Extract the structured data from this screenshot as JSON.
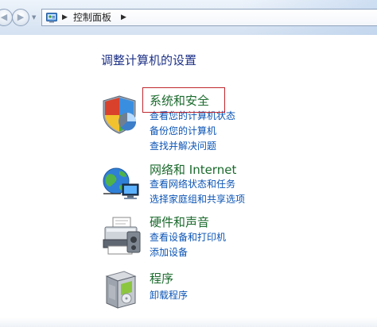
{
  "address_bar": {
    "location": "控制面板"
  },
  "page": {
    "heading": "调整计算机的设置"
  },
  "categories": [
    {
      "title": "系统和安全",
      "links": [
        "查看您的计算机状态",
        "备份您的计算机",
        "查找并解决问题"
      ]
    },
    {
      "title": "网络和 Internet",
      "links": [
        "查看网络状态和任务",
        "选择家庭组和共享选项"
      ]
    },
    {
      "title": "硬件和声音",
      "links": [
        "查看设备和打印机",
        "添加设备"
      ]
    },
    {
      "title": "程序",
      "links": [
        "卸载程序"
      ]
    }
  ],
  "icons": {
    "system_security": "shield-icon",
    "network": "globe-network-icon",
    "hardware": "printer-icon",
    "programs": "program-box-icon"
  },
  "colors": {
    "heading": "#1e3287",
    "category_title": "#1a6a2c",
    "link": "#0b54b5",
    "highlight": "#c0282d"
  }
}
